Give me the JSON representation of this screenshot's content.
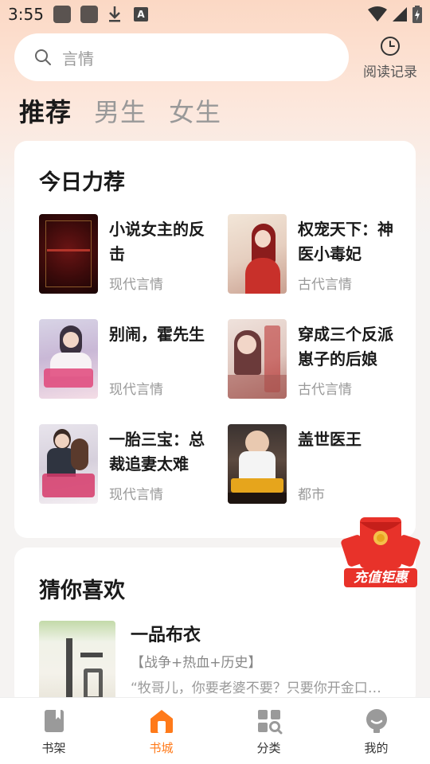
{
  "status_bar": {
    "time": "3:55"
  },
  "search": {
    "placeholder": "言情"
  },
  "history": {
    "label": "阅读记录"
  },
  "tabs": [
    {
      "label": "推荐",
      "active": true
    },
    {
      "label": "男生",
      "active": false
    },
    {
      "label": "女生",
      "active": false
    }
  ],
  "recommend": {
    "title": "今日力荐",
    "books": [
      {
        "title": "小说女主的反击",
        "category": "现代言情"
      },
      {
        "title": "权宠天下：神医小毒妃",
        "category": "古代言情"
      },
      {
        "title": "别闹，霍先生",
        "category": "现代言情"
      },
      {
        "title": "穿成三个反派崽子的后娘",
        "category": "古代言情"
      },
      {
        "title": "一胎三宝：总裁追妻太难",
        "category": "现代言情"
      },
      {
        "title": "盖世医王",
        "category": "都市"
      }
    ]
  },
  "guess": {
    "title": "猜你喜欢",
    "book": {
      "title": "一品布衣",
      "tags": "【战争+热血+历史】",
      "desc": "“牧哥儿，你要老婆不要？只要你开金口，一切好说”"
    }
  },
  "promo": {
    "label": "充值钜惠"
  },
  "bottom_nav": [
    {
      "label": "书架",
      "active": false
    },
    {
      "label": "书城",
      "active": true
    },
    {
      "label": "分类",
      "active": false
    },
    {
      "label": "我的",
      "active": false
    }
  ],
  "colors": {
    "accent": "#ff7a1a",
    "promo_red": "#e8322a"
  }
}
